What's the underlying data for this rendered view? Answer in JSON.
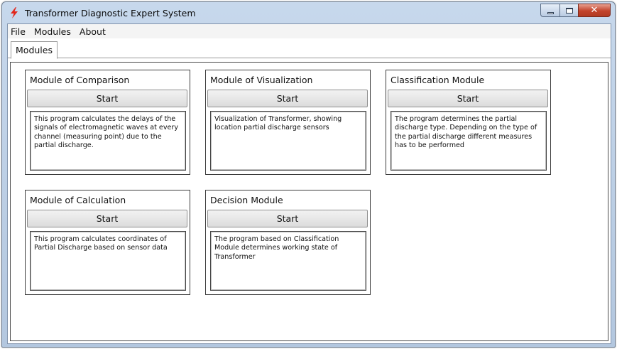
{
  "window": {
    "title": "Transformer Diagnostic Expert System",
    "controls": {
      "minimize_icon": "minimize-icon",
      "maximize_icon": "maximize-icon",
      "close_icon": "close-icon",
      "close_glyph": "✕"
    },
    "accent_close": "#c2432b"
  },
  "menu": {
    "items": [
      "File",
      "Modules",
      "About"
    ]
  },
  "tabs": [
    {
      "label": "Modules"
    }
  ],
  "modules": [
    {
      "title": "Module of Comparison",
      "button": "Start",
      "description": "This program calculates the delays of the signals of electromagnetic waves at every channel (measuring point) due to the partial discharge."
    },
    {
      "title": "Module of Visualization",
      "button": "Start",
      "description": "Visualization of Transformer, showing location partial discharge sensors"
    },
    {
      "title": "Classification Module",
      "button": "Start",
      "description": "The program determines the partial discharge type. Depending on the type of the partial discharge different measures has to be performed"
    },
    {
      "title": "Module of Calculation",
      "button": "Start",
      "description": "This program calculates coordinates of Partial Discharge based on sensor data"
    },
    {
      "title": "Decision Module",
      "button": "Start",
      "description": "The program based on Classification Module determines working state of Transformer"
    }
  ]
}
